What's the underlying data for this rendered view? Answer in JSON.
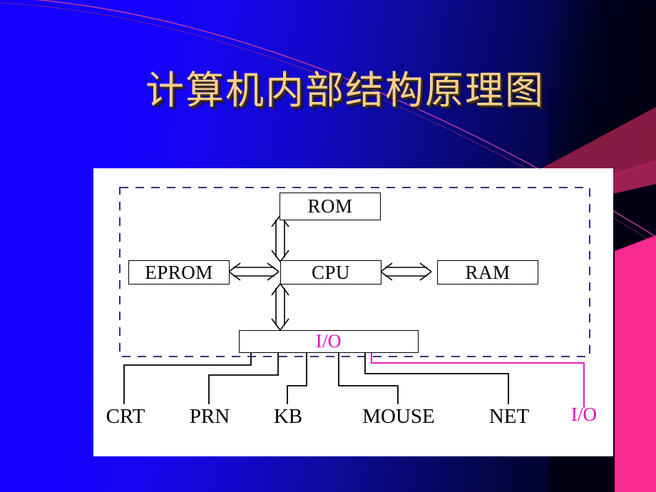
{
  "slide": {
    "title": "计算机内部结构原理图",
    "title_color": "#F6CE8E",
    "background_colors": {
      "blue": "#1400FF",
      "dark_navy": "#000014",
      "hot_pink": "#F72A8F",
      "maroon": "#A02050",
      "arc_line": "#D040A0"
    }
  },
  "diagram": {
    "panel_background": "#FFFFFF",
    "dashed_enclosure": {
      "label": "system-board-boundary",
      "stroke": "#1A1A6E",
      "style": "dashed"
    },
    "boxes": [
      {
        "id": "rom",
        "label": "ROM",
        "color": "#000000"
      },
      {
        "id": "eprom",
        "label": "EPROM",
        "color": "#000000"
      },
      {
        "id": "cpu",
        "label": "CPU",
        "color": "#000000"
      },
      {
        "id": "ram",
        "label": "RAM",
        "color": "#000000"
      },
      {
        "id": "io",
        "label": "I/O",
        "color": "#E800C8"
      }
    ],
    "connectors": [
      {
        "from": "cpu",
        "to": "rom",
        "type": "double-arrow",
        "orientation": "vertical"
      },
      {
        "from": "cpu",
        "to": "eprom",
        "type": "double-arrow",
        "orientation": "horizontal"
      },
      {
        "from": "cpu",
        "to": "ram",
        "type": "double-arrow",
        "orientation": "horizontal"
      },
      {
        "from": "cpu",
        "to": "io",
        "type": "double-arrow",
        "orientation": "vertical"
      }
    ],
    "peripherals": [
      {
        "id": "crt",
        "label": "CRT",
        "color": "#000000"
      },
      {
        "id": "prn",
        "label": "PRN",
        "color": "#000000"
      },
      {
        "id": "kb",
        "label": "KB",
        "color": "#000000"
      },
      {
        "id": "mouse",
        "label": "MOUSE",
        "color": "#000000"
      },
      {
        "id": "net",
        "label": "NET",
        "color": "#000000"
      },
      {
        "id": "io2",
        "label": "I/O",
        "color": "#E800C8"
      }
    ]
  }
}
